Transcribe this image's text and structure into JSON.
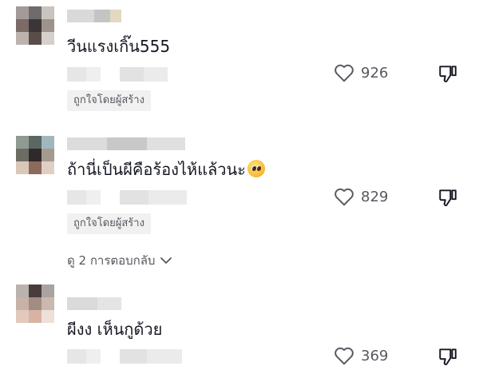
{
  "comments": [
    {
      "text": "วีนแรงเกิ๊น555",
      "likes": "926",
      "creator_badge": "ถูกใจโดยผู้สร้าง"
    },
    {
      "text": "ถ้านี่เป็นผีคือร้องไห้แล้วนะ",
      "emoji": "pleading-face-emoji",
      "likes": "829",
      "creator_badge": "ถูกใจโดยผู้สร้าง",
      "view_replies": "ดู 2 การตอบกลับ"
    },
    {
      "text": "ผีงง เห็นกูด้วย",
      "likes": "369"
    }
  ],
  "icons": {
    "like": "heart-outline-icon",
    "dislike": "thumbs-down-outline-icon",
    "expand": "chevron-down-icon"
  },
  "colors": {
    "text_primary": "#161823",
    "text_secondary": "#57585f",
    "badge_bg": "#f1f1f2"
  }
}
